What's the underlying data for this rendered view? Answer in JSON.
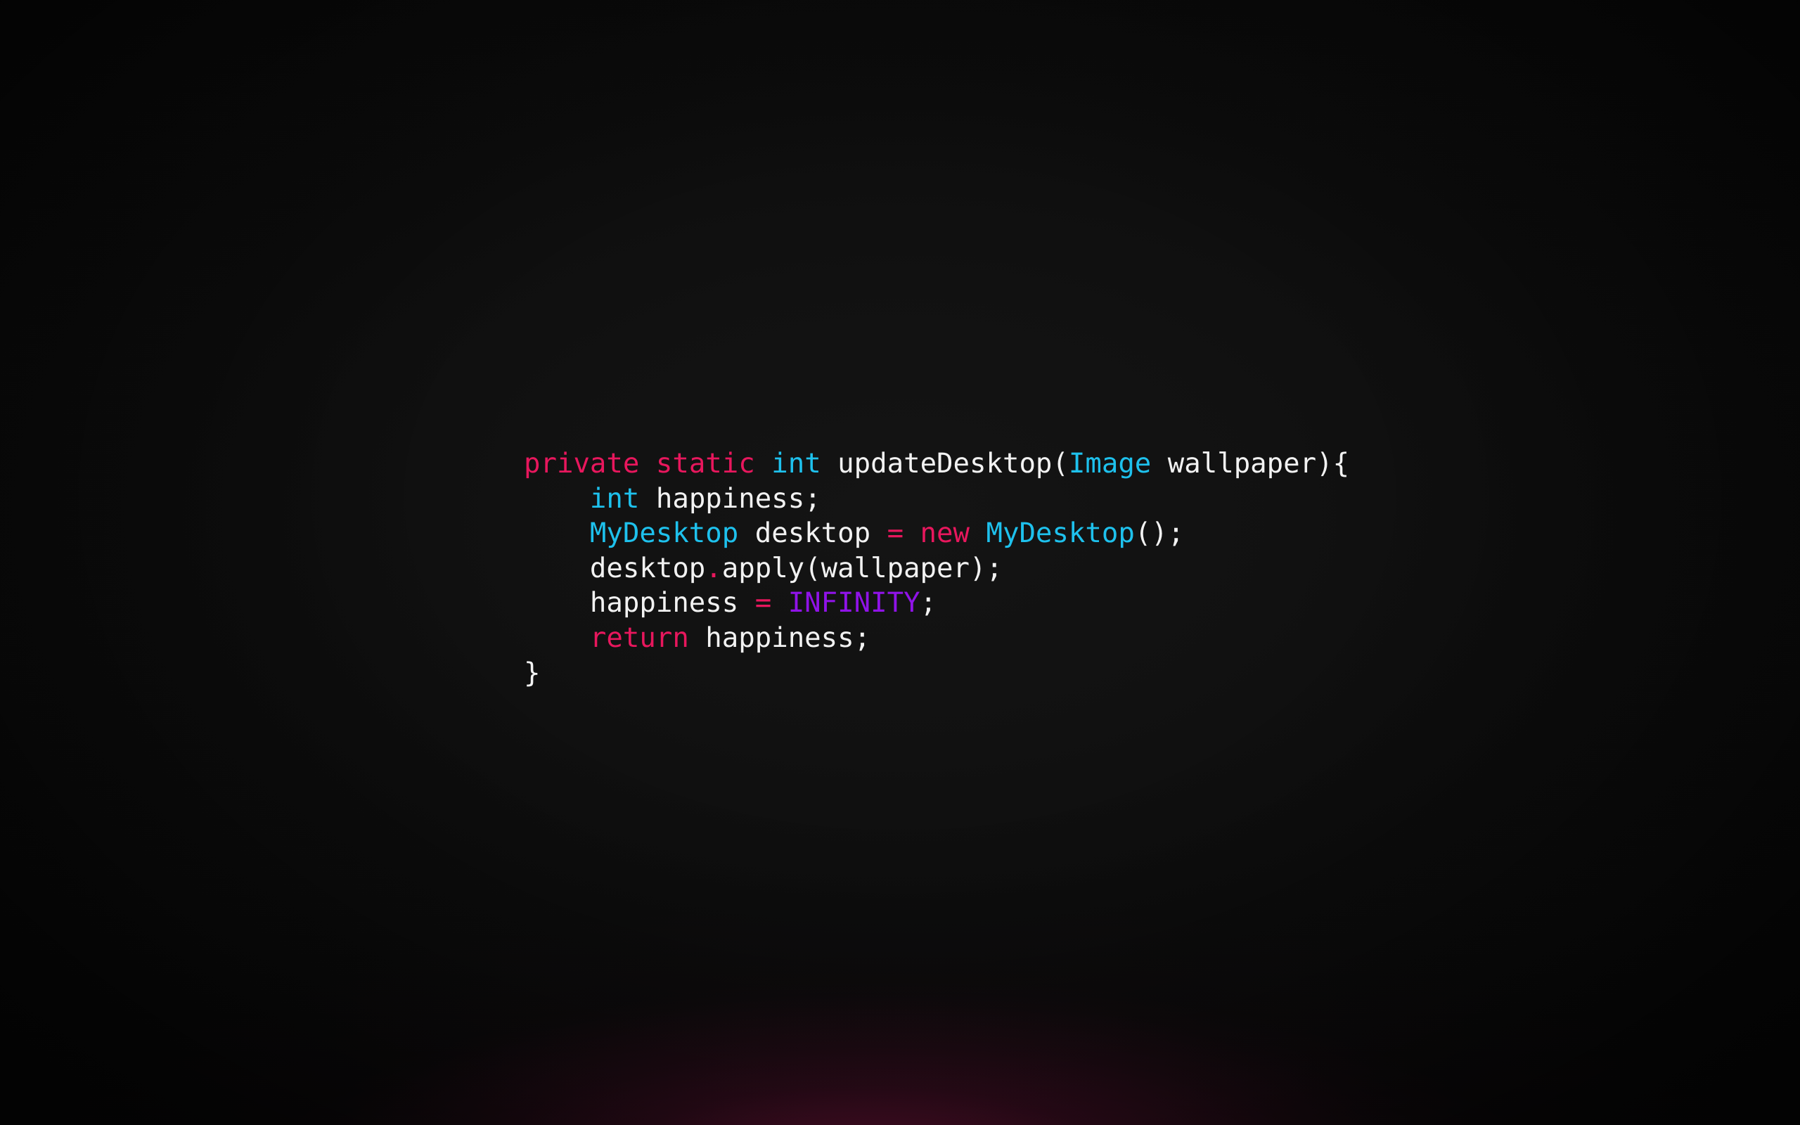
{
  "wallpaper": {
    "type": "code-wallpaper",
    "background": {
      "base_color": "#0d0d0d",
      "bloom_color": "#be185d",
      "vignette": true
    }
  },
  "colors": {
    "keyword": "#e8175d",
    "type": "#1ec1ed",
    "plain": "#f2f2f2",
    "constant": "#9013e8",
    "operator": "#e8175d",
    "punctuation": "#f2f2f2"
  },
  "code": {
    "language": "java",
    "snippet_text": "private static int updateDesktop(Image wallpaper){\n    int happiness;\n    MyDesktop desktop = new MyDesktop();\n    desktop.apply(wallpaper);\n    happiness = INFINITY;\n    return happiness;\n}",
    "lines": [
      {
        "index": 1,
        "tokens": [
          {
            "text": "private",
            "color_role": "keyword"
          },
          {
            "text": " ",
            "color_role": "plain"
          },
          {
            "text": "static",
            "color_role": "keyword"
          },
          {
            "text": " ",
            "color_role": "plain"
          },
          {
            "text": "int",
            "color_role": "type"
          },
          {
            "text": " updateDesktop(",
            "color_role": "plain"
          },
          {
            "text": "Image",
            "color_role": "type"
          },
          {
            "text": " wallpaper){",
            "color_role": "plain"
          }
        ]
      },
      {
        "index": 2,
        "tokens": [
          {
            "text": "    ",
            "color_role": "plain"
          },
          {
            "text": "int",
            "color_role": "type"
          },
          {
            "text": " happiness;",
            "color_role": "plain"
          }
        ]
      },
      {
        "index": 3,
        "tokens": [
          {
            "text": "    ",
            "color_role": "plain"
          },
          {
            "text": "MyDesktop",
            "color_role": "type"
          },
          {
            "text": " desktop ",
            "color_role": "plain"
          },
          {
            "text": "=",
            "color_role": "operator"
          },
          {
            "text": " ",
            "color_role": "plain"
          },
          {
            "text": "new",
            "color_role": "keyword"
          },
          {
            "text": " ",
            "color_role": "plain"
          },
          {
            "text": "MyDesktop",
            "color_role": "type"
          },
          {
            "text": "();",
            "color_role": "plain"
          }
        ]
      },
      {
        "index": 4,
        "tokens": [
          {
            "text": "    desktop",
            "color_role": "plain"
          },
          {
            "text": ".",
            "color_role": "operator"
          },
          {
            "text": "apply(wallpaper);",
            "color_role": "plain"
          }
        ]
      },
      {
        "index": 5,
        "tokens": [
          {
            "text": "    happiness ",
            "color_role": "plain"
          },
          {
            "text": "=",
            "color_role": "operator"
          },
          {
            "text": " ",
            "color_role": "plain"
          },
          {
            "text": "INFINITY",
            "color_role": "constant"
          },
          {
            "text": ";",
            "color_role": "plain"
          }
        ]
      },
      {
        "index": 6,
        "tokens": [
          {
            "text": "    ",
            "color_role": "plain"
          },
          {
            "text": "return",
            "color_role": "keyword"
          },
          {
            "text": " happiness;",
            "color_role": "plain"
          }
        ]
      },
      {
        "index": 7,
        "tokens": [
          {
            "text": "}",
            "color_role": "plain"
          }
        ]
      }
    ]
  }
}
